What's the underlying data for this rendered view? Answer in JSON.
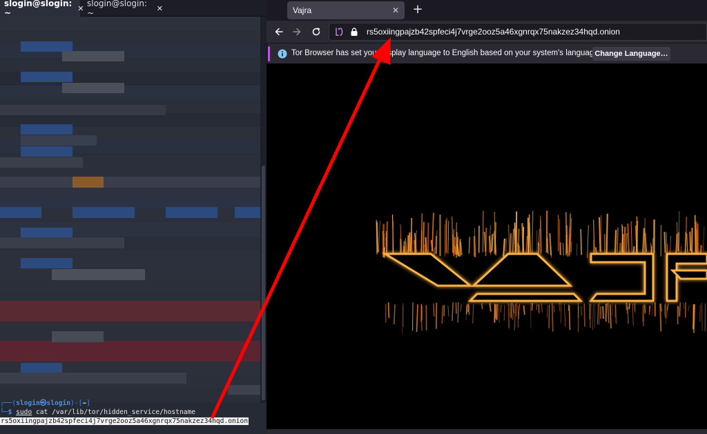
{
  "terminal": {
    "tabs": [
      {
        "label": "slogin@slogin: ~",
        "close": "✕",
        "active": true
      },
      {
        "label": "slogin@slogin: ~",
        "close": "✕",
        "active": false
      }
    ],
    "prompt": {
      "top_left": "┌──(",
      "user_host": "slogin㉿slogin",
      "mid": ")-[",
      "path": "~",
      "end": "]",
      "bottom_left": "└─",
      "dollar": "$"
    },
    "command": {
      "sudo": "sudo",
      "rest": " cat /var/lib/tor/hidden_service/hostname"
    },
    "output": "rs5oxiingpajzb42spfeci4j7vrge2ooz5a46xgnrqx75nakzez34hqd.onion"
  },
  "browser": {
    "tab": {
      "title": "Vajra",
      "close": "✕"
    },
    "new_tab": "+",
    "url": "rs5oxiingpajzb42spfeci4j7vrge2ooz5a46xgnrqx75nakzez34hqd.onion",
    "notification": {
      "text": "Tor Browser has set your display language to English based on your system's language.",
      "button": "Change Language…"
    },
    "colors": {
      "tab_bg": "#42414d",
      "toolbar": "#2b2a33",
      "content_bg": "#000000",
      "accent": "#b45be0"
    }
  },
  "annotation": {
    "color": "#ff0000"
  },
  "icons": {
    "back": "arrow-left-icon",
    "forward": "arrow-right-icon",
    "reload": "reload-icon",
    "onion": "onion-circuit-icon",
    "lock": "lock-icon",
    "info": "info-icon"
  }
}
